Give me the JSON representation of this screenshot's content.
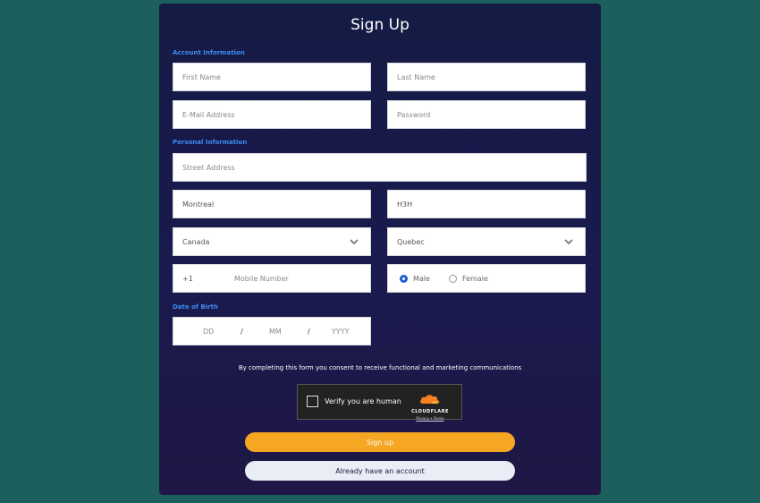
{
  "title": "Sign Up",
  "sections": {
    "account": "Account Information",
    "personal": "Personal Information",
    "dob": "Date of Birth"
  },
  "fields": {
    "first_name": {
      "placeholder": "First Name"
    },
    "last_name": {
      "placeholder": "Last Name"
    },
    "email": {
      "placeholder": "E-Mail Address"
    },
    "password": {
      "placeholder": "Password"
    },
    "street": {
      "placeholder": "Street Address"
    },
    "city": {
      "value": "Montreal"
    },
    "postal": {
      "value": "H3H"
    },
    "country": {
      "value": "Canada"
    },
    "province": {
      "value": "Quebec"
    },
    "phone_prefix": "+1",
    "mobile": {
      "placeholder": "Mobile Number"
    },
    "gender": {
      "male": "Male",
      "female": "Female",
      "selected": "male"
    },
    "dob": {
      "dd": "DD",
      "sep1": "/",
      "mm": "MM",
      "sep2": "/",
      "yyyy": "YYYY"
    }
  },
  "consent_text": "By completing this form you consent to receive functional and marketing communications",
  "captcha": {
    "label": "Verify you are human",
    "brand": "CLOUDFLARE",
    "links": "Privacy • Terms"
  },
  "buttons": {
    "signup": "Sign up",
    "login": "Already have an account"
  },
  "colors": {
    "accent": "#f5a623",
    "section": "#3d8bf2",
    "panel": "#171b48",
    "background": "#1d5f5c"
  }
}
